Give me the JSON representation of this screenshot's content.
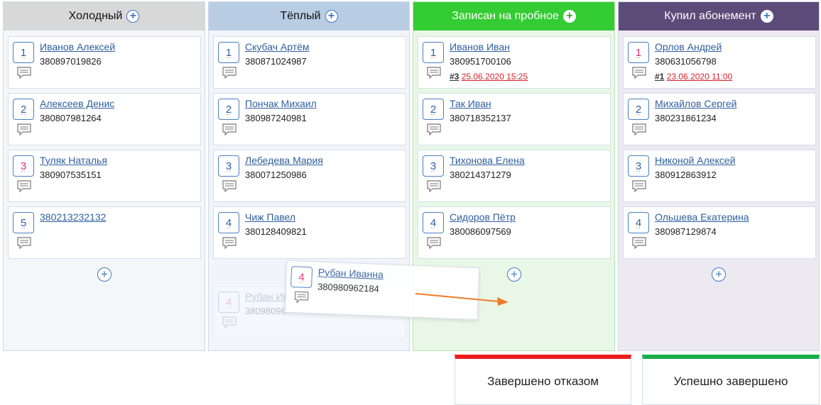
{
  "colors": {
    "cold_header": "#d8d8d8",
    "cold_body": "#f4f6f9",
    "warm_header": "#b8cde4",
    "warm_body": "#f1f5fa",
    "trial_header": "#33cc33",
    "trial_body": "#e9f8e6",
    "bought_header": "#5c4b79",
    "bought_body": "#ece9f1",
    "link": "#2f5f9e",
    "due_date": "#d4232a",
    "refuse_bar": "#ee1c1c",
    "success_bar": "#1aac4a",
    "drag_arrow": "#f07b2a"
  },
  "columns": [
    {
      "title": "Холодный",
      "add_icon": "plus-circle-icon",
      "cards": [
        {
          "num": "1",
          "name": "Иванов Алексей",
          "phone": "380897019826",
          "icon": "comment-icon"
        },
        {
          "num": "2",
          "name": "Алексеев Денис",
          "phone": "380807981264",
          "icon": "comment-icon"
        },
        {
          "num": "3",
          "name": "Туляк Наталья",
          "phone": "380907535151",
          "icon": "comment-icon"
        },
        {
          "num": "5",
          "name": "380213232132",
          "phone": "",
          "icon": "comment-icon"
        }
      ]
    },
    {
      "title": "Тёплый",
      "add_icon": "plus-circle-icon",
      "cards": [
        {
          "num": "1",
          "name": "Скубач Артём",
          "phone": "380871024987",
          "icon": "comment-icon"
        },
        {
          "num": "2",
          "name": "Пончак Михаил",
          "phone": "380987240981",
          "icon": "comment-icon"
        },
        {
          "num": "3",
          "name": "Лебедева Мария",
          "phone": "380071250986",
          "icon": "comment-icon"
        },
        {
          "num": "4",
          "name": "Чиж Павел",
          "phone": "380128409821",
          "icon": "comment-icon"
        }
      ],
      "ghost_card": {
        "num": "4",
        "name": "Рубан Ив",
        "phone": "38098096"
      }
    },
    {
      "title": "Записан на пробное",
      "add_icon": "plus-circle-icon",
      "cards": [
        {
          "num": "1",
          "name": "Иванов Иван",
          "phone": "380951700106",
          "ref": "#3",
          "date": "25.06.2020 15:25",
          "icon": "comment-icon"
        },
        {
          "num": "2",
          "name": "Так Иван",
          "phone": "380718352137",
          "icon": "comment-icon"
        },
        {
          "num": "3",
          "name": "Тихонова Елена",
          "phone": "380214371279",
          "icon": "comment-icon"
        },
        {
          "num": "4",
          "name": "Сидоров Пётр",
          "phone": "380086097569",
          "icon": "comment-icon"
        }
      ]
    },
    {
      "title": "Купил абонемент",
      "add_icon": "plus-circle-icon",
      "cards": [
        {
          "num": "1",
          "name": "Орлов Андрей",
          "phone": "380631056798",
          "ref": "#1",
          "date": "23.06.2020 11:00",
          "icon": "comment-icon"
        },
        {
          "num": "2",
          "name": "Михайлов Сергей",
          "phone": "380231861234",
          "icon": "comment-icon"
        },
        {
          "num": "3",
          "name": "Никоной Алексей",
          "phone": "380912863912",
          "icon": "comment-icon"
        },
        {
          "num": "4",
          "name": "Ольшева Екатерина",
          "phone": "380987129874",
          "icon": "comment-icon"
        }
      ]
    }
  ],
  "dragging_card": {
    "num": "4",
    "name": "Рубан Иванна",
    "phone": "380980962184",
    "icon": "comment-icon"
  },
  "drop_zones": {
    "refused": "Завершено отказом",
    "success": "Успешно завершено"
  }
}
